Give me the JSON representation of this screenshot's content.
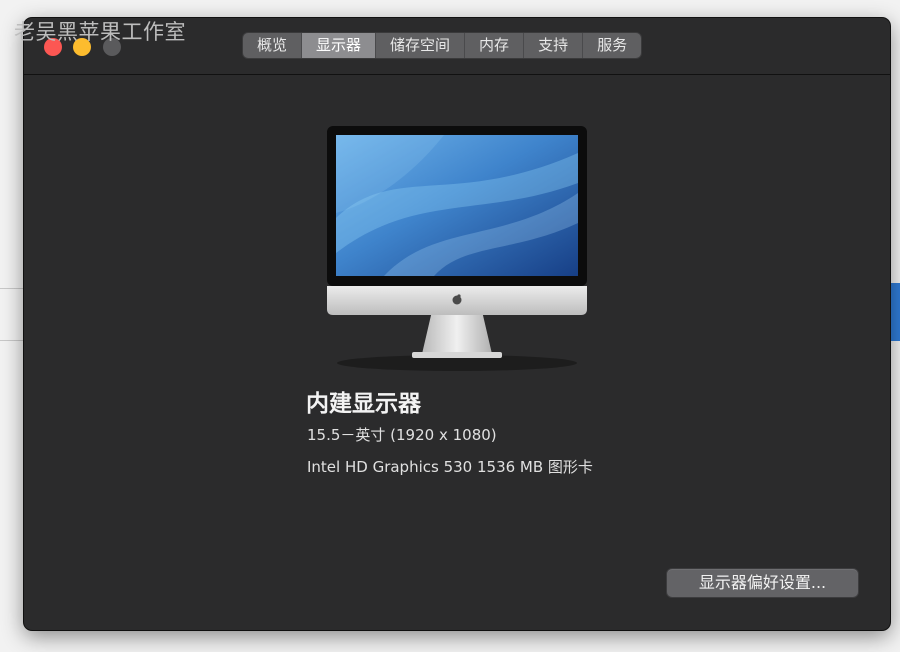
{
  "watermark": "老吴黑苹果工作室",
  "window": {
    "tabs": [
      {
        "label": "概览",
        "active": false
      },
      {
        "label": "显示器",
        "active": true
      },
      {
        "label": "储存空间",
        "active": false
      },
      {
        "label": "内存",
        "active": false
      },
      {
        "label": "支持",
        "active": false
      },
      {
        "label": "服务",
        "active": false
      }
    ]
  },
  "display": {
    "name": "内建显示器",
    "size": "15.5－英寸 (1920 x 1080)",
    "graphics": "Intel HD Graphics 530 1536 MB 图形卡",
    "icon": "imac-icon"
  },
  "prefs_button": "显示器偏好设置...",
  "colors": {
    "close": "#fc5753",
    "minimize": "#fdbc2e",
    "zoom_inactive": "#5a5a5c",
    "window_bg": "#2b2b2c",
    "active_tab": "#8d8d90"
  }
}
